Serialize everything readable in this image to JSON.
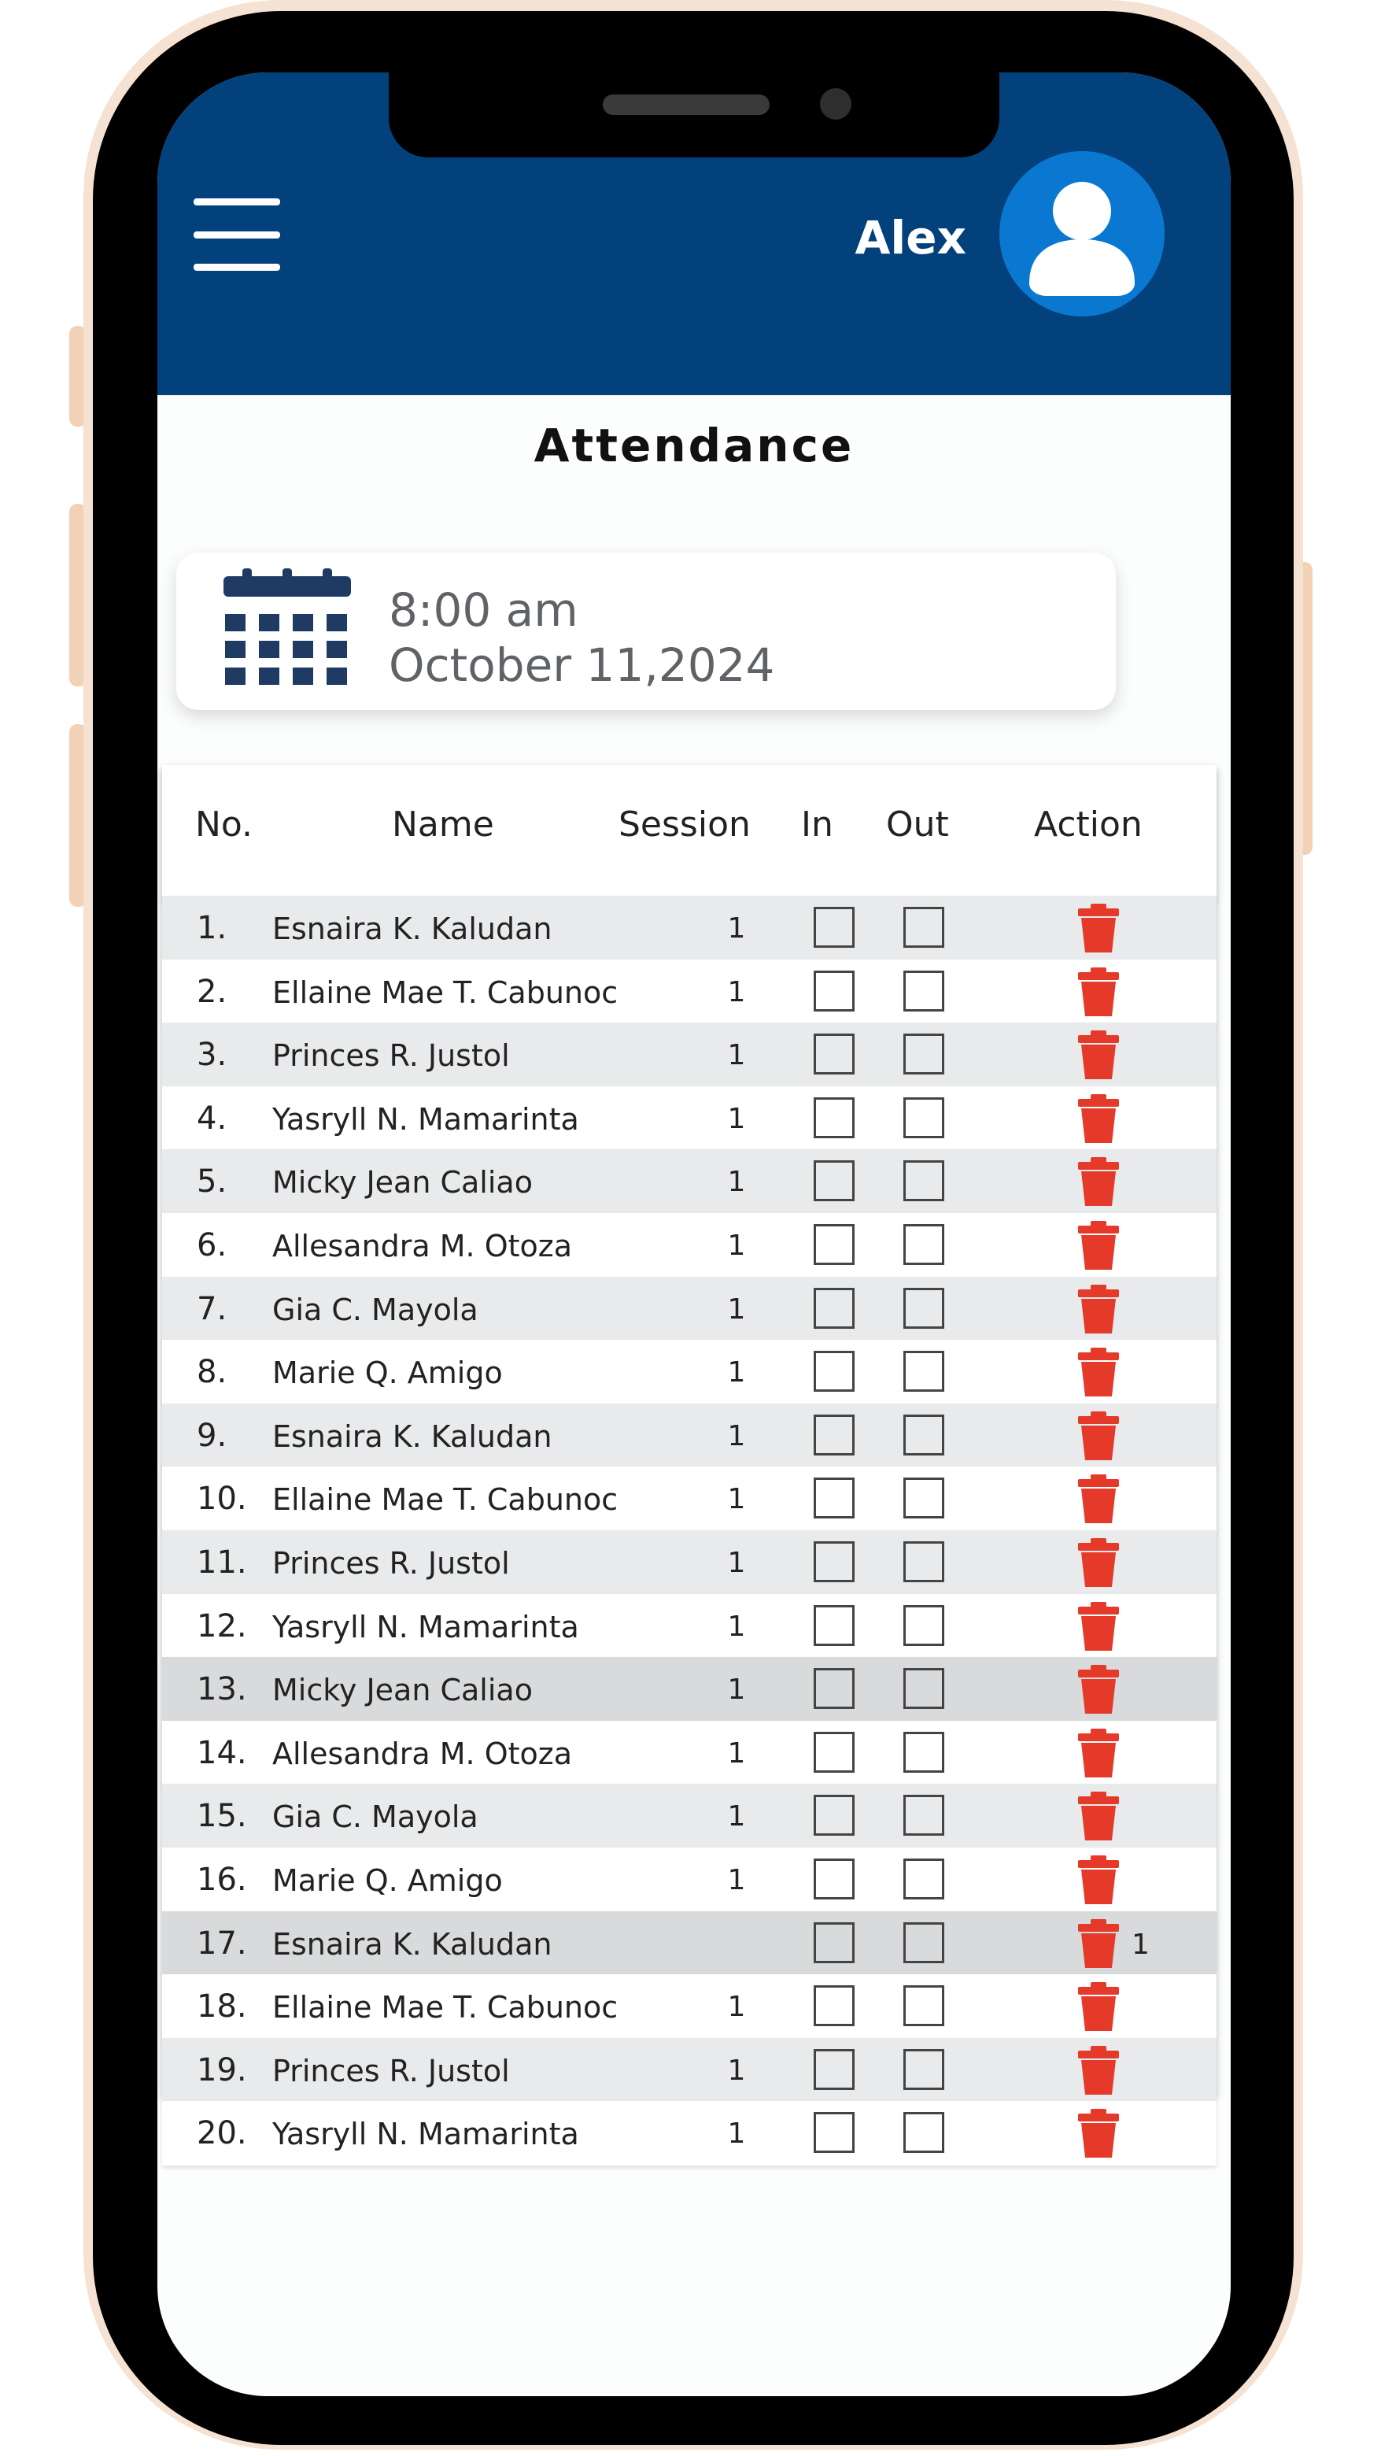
{
  "header": {
    "username": "Alex"
  },
  "page": {
    "title": "Attendance"
  },
  "session_info": {
    "time": "8:00 am",
    "date": "October 11,2024"
  },
  "table": {
    "columns": {
      "no": "No.",
      "name": "Name",
      "session": "Session",
      "in": "In",
      "out": "Out",
      "action": "Action"
    },
    "rows": [
      {
        "no": "1.",
        "name": "Esnaira K. Kaludan",
        "session": "1",
        "extra": ""
      },
      {
        "no": "2.",
        "name": "Ellaine Mae T. Cabunoc",
        "session": "1",
        "extra": ""
      },
      {
        "no": "3.",
        "name": "Princes R. Justol",
        "session": "1",
        "extra": ""
      },
      {
        "no": "4.",
        "name": "Yasryll N. Mamarinta",
        "session": "1",
        "extra": ""
      },
      {
        "no": "5.",
        "name": "Micky Jean Caliao",
        "session": "1",
        "extra": ""
      },
      {
        "no": "6.",
        "name": "Allesandra M. Otoza",
        "session": "1",
        "extra": ""
      },
      {
        "no": "7.",
        "name": "Gia C. Mayola",
        "session": "1",
        "extra": ""
      },
      {
        "no": "8.",
        "name": "Marie Q. Amigo",
        "session": "1",
        "extra": ""
      },
      {
        "no": "9.",
        "name": "Esnaira K. Kaludan",
        "session": "1",
        "extra": ""
      },
      {
        "no": "10.",
        "name": "Ellaine Mae T. Cabunoc",
        "session": "1",
        "extra": ""
      },
      {
        "no": "11.",
        "name": "Princes R. Justol",
        "session": "1",
        "extra": ""
      },
      {
        "no": "12.",
        "name": "Yasryll N. Mamarinta",
        "session": "1",
        "extra": ""
      },
      {
        "no": "13.",
        "name": "Micky Jean Caliao",
        "session": "1",
        "extra": ""
      },
      {
        "no": "14.",
        "name": "Allesandra M. Otoza",
        "session": "1",
        "extra": ""
      },
      {
        "no": "15.",
        "name": "Gia C. Mayola",
        "session": "1",
        "extra": ""
      },
      {
        "no": "16.",
        "name": "Marie Q. Amigo",
        "session": "1",
        "extra": ""
      },
      {
        "no": "17.",
        "name": "Esnaira K. Kaludan",
        "session": "",
        "extra": "1"
      },
      {
        "no": "18.",
        "name": "Ellaine Mae T. Cabunoc",
        "session": "1",
        "extra": ""
      },
      {
        "no": "19.",
        "name": "Princes R. Justol",
        "session": "1",
        "extra": ""
      },
      {
        "no": "20.",
        "name": "Yasryll N. Mamarinta",
        "session": "1",
        "extra": ""
      }
    ]
  },
  "icons": {
    "menu": "hamburger-menu-icon",
    "avatar": "user-avatar-icon",
    "calendar": "calendar-icon",
    "delete": "trash-icon"
  },
  "colors": {
    "header": "#03417d",
    "avatar": "#0a78d0",
    "delete": "#e53a2a",
    "calendar": "#1f3b63"
  }
}
